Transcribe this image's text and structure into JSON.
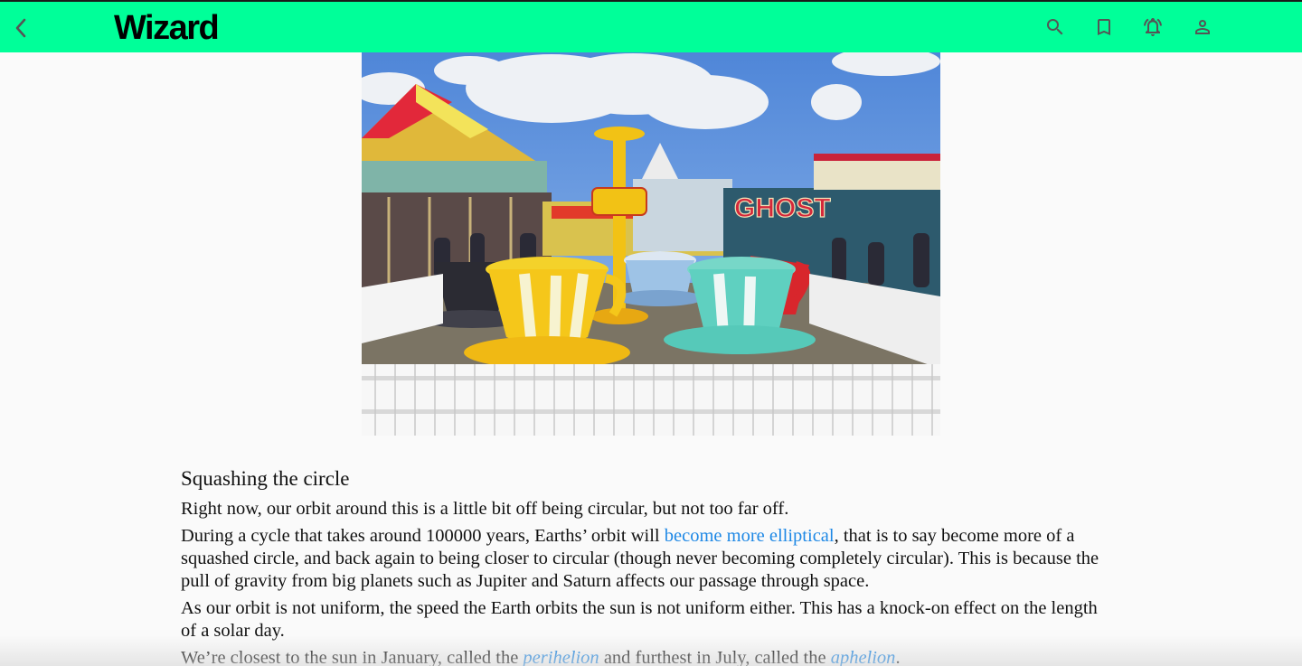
{
  "header": {
    "brand": "Wizard",
    "background_color": "#00ff99",
    "icons": [
      "back-chevron-icon",
      "search-icon",
      "bookmark-icon",
      "notification-bell-icon",
      "account-icon"
    ]
  },
  "hero_image": {
    "subject": "fairground teacup ride with carousel and Ghost ride behind",
    "sign_text": "GHOST"
  },
  "article": {
    "heading": "Squashing the circle",
    "p1": "Right now, our orbit around this is a little bit off being circular, but not too far off.",
    "p2_before": "During a cycle that takes around 100000 years, Earths’ orbit will ",
    "p2_link": "become more elliptical",
    "p2_after": ", that is to say become more of a squashed circle, and back again to being closer to circular (though never becoming completely circular). This is because the pull of gravity from big planets such as Jupiter and Saturn affects our passage through space.",
    "p3": "As our orbit is not uniform, the speed the Earth orbits the sun is not uniform either. This has a knock-on effect on the length of a solar day.",
    "p4_before": "We’re closest to the sun in January, called the ",
    "p4_link1": "perihelion",
    "p4_middle": " and furthest in July, called the ",
    "p4_link2": "aphelion",
    "p4_after": ".",
    "link_color": "#1e88e5"
  }
}
